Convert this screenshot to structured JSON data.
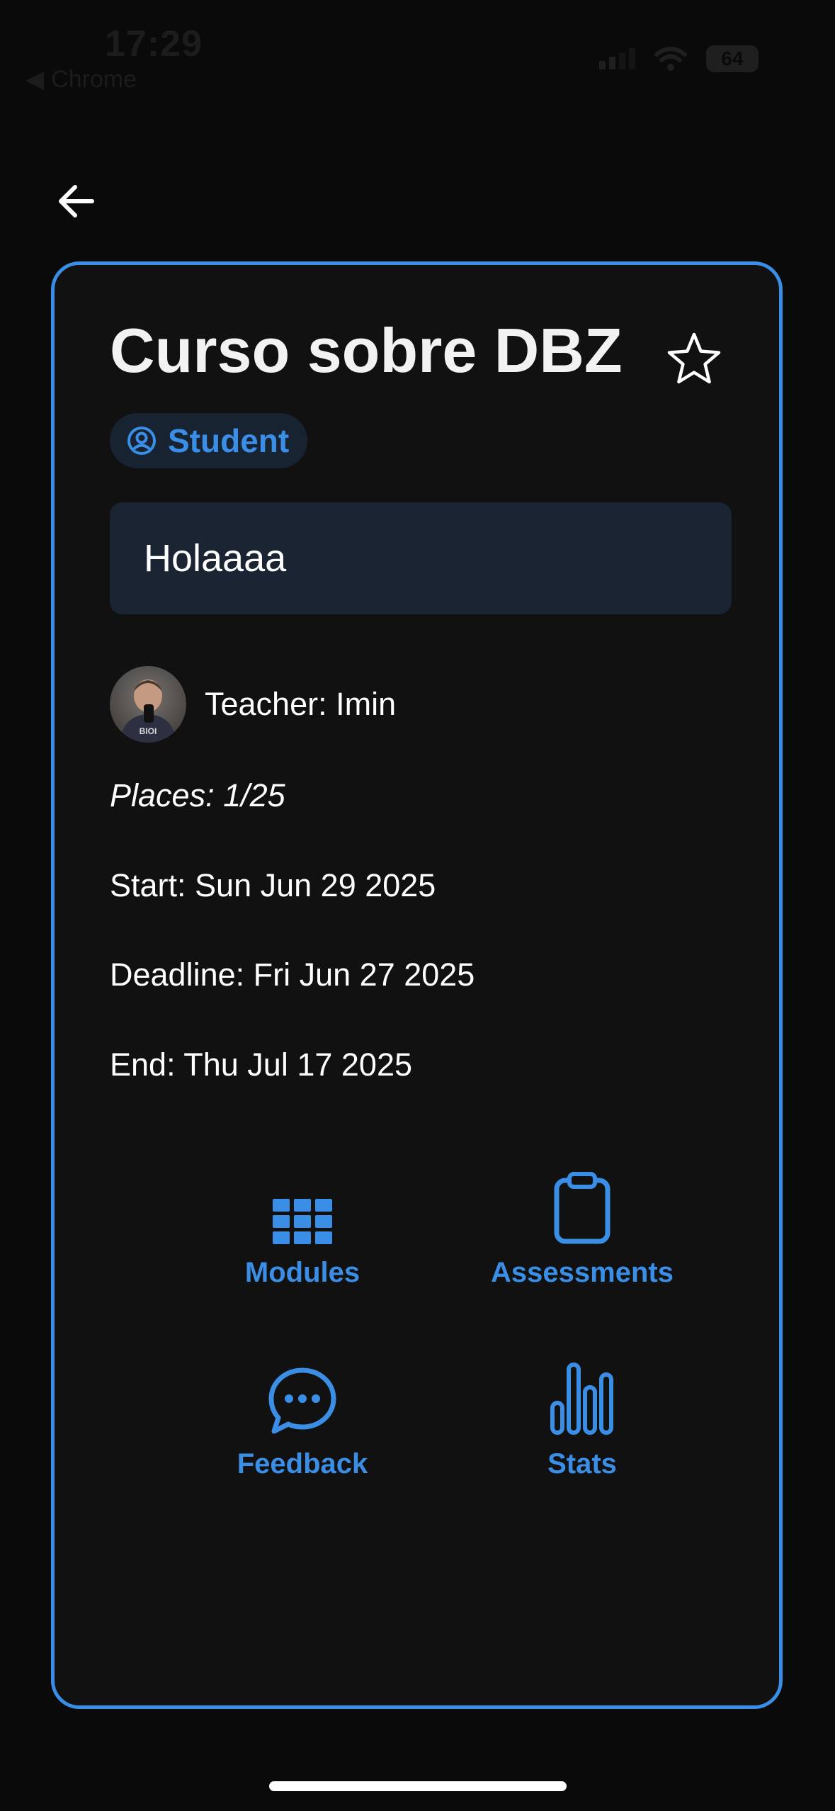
{
  "status_bar": {
    "time": "17:29",
    "back_app": "Chrome",
    "battery": "64"
  },
  "icons": {
    "back": "arrow-left-icon",
    "favorite": "star-outline-icon",
    "role": "user-circle-icon",
    "modules": "grid-icon",
    "assessments": "clipboard-icon",
    "feedback": "chat-bubble-icon",
    "stats": "bar-chart-icon"
  },
  "colors": {
    "accent": "#3a8ee6",
    "background": "#0a0a0a",
    "card": "#111111",
    "desc_box": "#1a2433",
    "badge": "#182332"
  },
  "course": {
    "title": "Curso sobre DBZ",
    "role": "Student",
    "description": "Holaaaa",
    "teacher": "Teacher: Imin",
    "places": "Places: 1/25",
    "start": "Start: Sun Jun 29 2025",
    "deadline": "Deadline: Fri Jun 27 2025",
    "end": "End: Thu Jul 17 2025"
  },
  "actions": {
    "modules": "Modules",
    "assessments": "Assessments",
    "feedback": "Feedback",
    "stats": "Stats"
  }
}
